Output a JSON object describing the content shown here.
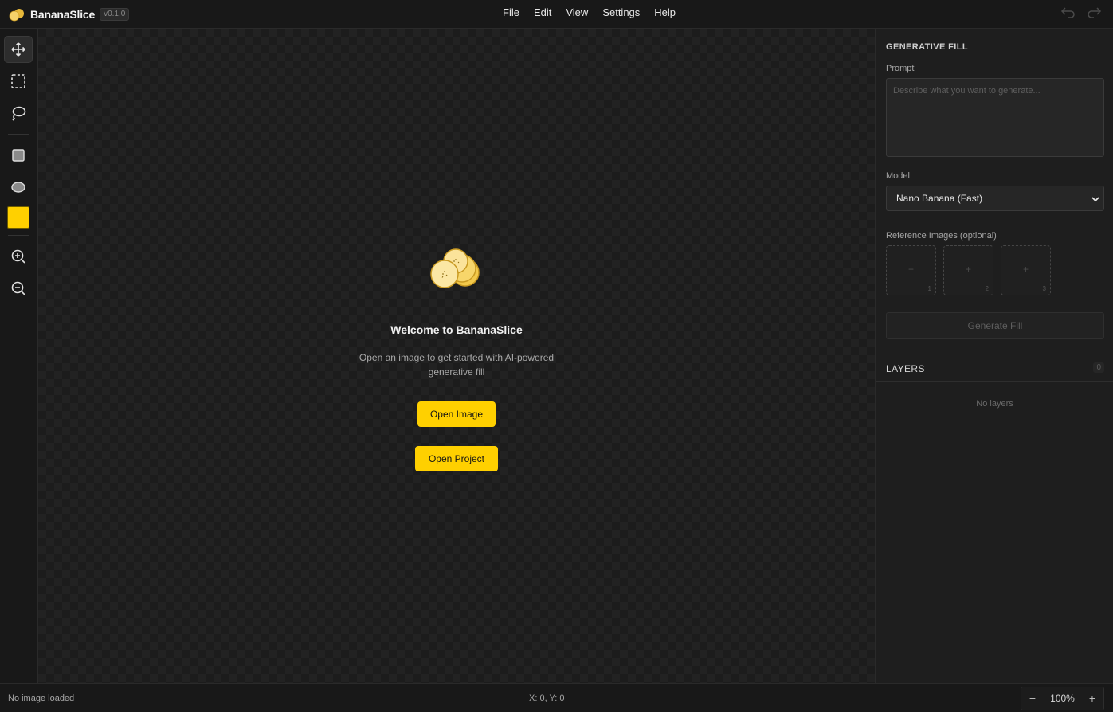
{
  "app": {
    "name": "BananaSlice",
    "version": "v0.1.0"
  },
  "menu": [
    "File",
    "Edit",
    "View",
    "Settings",
    "Help"
  ],
  "toolbar": {
    "tools": [
      "move-icon",
      "rect-select-icon",
      "lasso-icon",
      "rectangle-shape-icon",
      "ellipse-shape-icon",
      "zoom-in-icon",
      "zoom-out-icon"
    ],
    "active_tool": "move-icon",
    "foreground_color": "#FFD000"
  },
  "welcome": {
    "title": "Welcome to BananaSlice",
    "description": "Open an image to get started with AI-powered generative fill",
    "open_image": "Open Image",
    "open_project": "Open Project"
  },
  "panel": {
    "generative_fill": {
      "title": "GENERATIVE FILL",
      "prompt_label": "Prompt",
      "prompt_placeholder": "Describe what you want to generate...",
      "model_label": "Model",
      "model_value": "Nano Banana (Fast)",
      "reference_label": "Reference Images (optional)",
      "reference_slots": [
        "1",
        "2",
        "3"
      ],
      "generate_label": "Generate Fill"
    },
    "layers": {
      "title": "LAYERS",
      "count": "0",
      "empty": "No layers"
    }
  },
  "status": {
    "left": "No image loaded",
    "coords": "X: 0, Y: 0",
    "zoom": "100%",
    "zoom_out": "−",
    "zoom_in": "+"
  },
  "colors": {
    "accent": "#FFD000",
    "background": "#1A1A1A"
  }
}
